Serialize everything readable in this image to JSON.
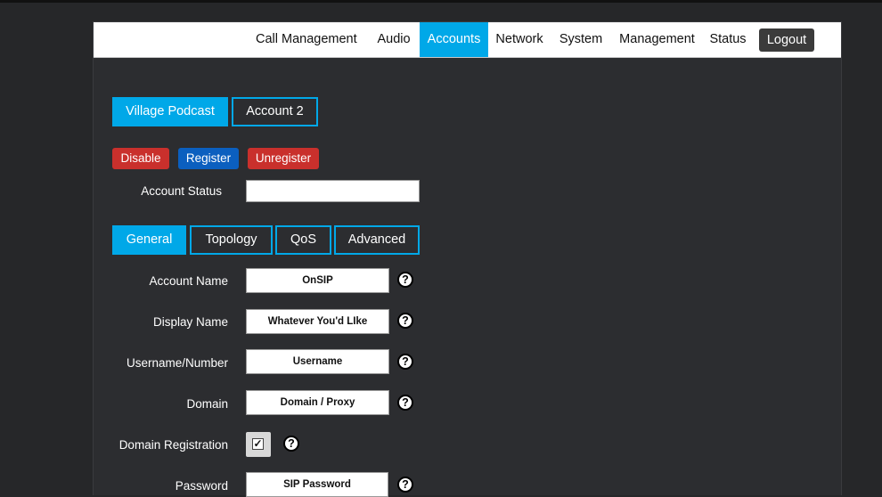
{
  "nav": {
    "items": [
      {
        "label": "Call Management"
      },
      {
        "label": "Audio"
      },
      {
        "label": "Accounts"
      },
      {
        "label": "Network"
      },
      {
        "label": "System"
      },
      {
        "label": "Management"
      },
      {
        "label": "Status"
      }
    ],
    "active": "Accounts",
    "logout_label": "Logout"
  },
  "account_tabs": [
    {
      "label": "Village Podcast"
    },
    {
      "label": "Account 2"
    }
  ],
  "actions": {
    "disable_label": "Disable",
    "register_label": "Register",
    "unregister_label": "Unregister"
  },
  "account_status": {
    "label": "Account Status",
    "value": ""
  },
  "settings_tabs": [
    {
      "label": "General"
    },
    {
      "label": "Topology"
    },
    {
      "label": "QoS"
    },
    {
      "label": "Advanced"
    }
  ],
  "form": {
    "account_name": {
      "label": "Account Name",
      "value": "OnSIP"
    },
    "display_name": {
      "label": "Display Name",
      "value": "Whatever You'd LIke"
    },
    "username": {
      "label": "Username/Number",
      "value": "Username"
    },
    "domain": {
      "label": "Domain",
      "value": "Domain / Proxy"
    },
    "domain_registration": {
      "label": "Domain Registration",
      "checked": true
    },
    "password": {
      "label": "Password",
      "value": "SIP Password"
    }
  },
  "help_symbol": "?",
  "check_symbol": "✓",
  "colors": {
    "accent": "#00a8e8",
    "danger": "#c9302c",
    "primary": "#0b5fbf",
    "background": "#262729"
  }
}
